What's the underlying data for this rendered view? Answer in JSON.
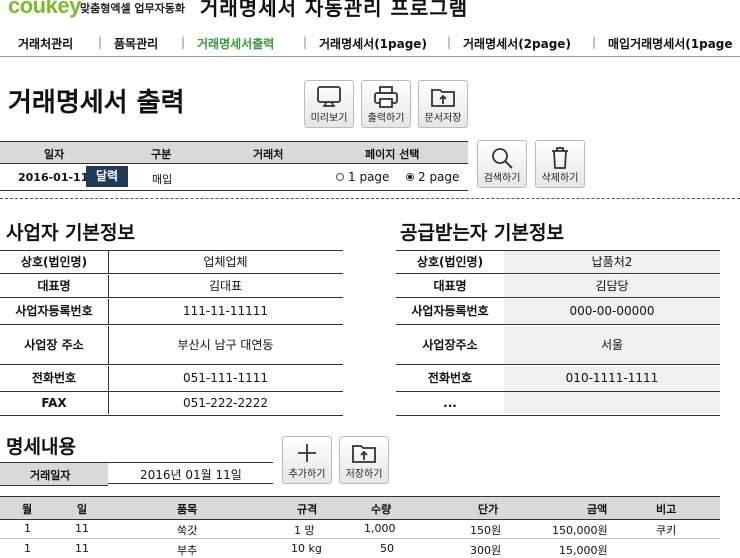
{
  "header": {
    "logo": "coukey",
    "logo_sub": "맞춤형엑셀 업무자동화",
    "app_title": "거래명세서 자동관리 프로그램"
  },
  "nav": {
    "items": [
      {
        "label": "거래처관리"
      },
      {
        "label": "품목관리"
      },
      {
        "label": "거래명세서출력"
      },
      {
        "label": "거래명세서(1page)"
      },
      {
        "label": "거래명세서(2page)"
      },
      {
        "label": "매입거래명세서(1page"
      }
    ],
    "separator": "|"
  },
  "page_title": "거래명세서 출력",
  "toolbar": {
    "preview": "미리보기",
    "print": "출력하기",
    "save_doc": "문서저장"
  },
  "search_bar": {
    "headers": {
      "date": "일자",
      "category": "구분",
      "client": "거래처",
      "page_select": "페이지 선택"
    },
    "date_value": "2016-01-11",
    "calendar_button": "달력",
    "category_value": "매입",
    "page_options": [
      {
        "label": "1 page",
        "selected": false
      },
      {
        "label": "2 page",
        "selected": true
      }
    ],
    "search_button": "검색하기",
    "delete_button": "삭제하기"
  },
  "supplier": {
    "title": "사업자 기본정보",
    "rows": [
      {
        "label": "상호(법인명)",
        "value": "업체업체"
      },
      {
        "label": "대표명",
        "value": "김대표"
      },
      {
        "label": "사업자등록번호",
        "value": "111-11-11111"
      },
      {
        "label": "사업장 주소",
        "value": "부산시 남구 대연동"
      },
      {
        "label": "전화번호",
        "value": "051-111-1111"
      },
      {
        "label": "FAX",
        "value": "051-222-2222"
      }
    ]
  },
  "receiver": {
    "title": "공급받는자 기본정보",
    "rows": [
      {
        "label": "상호(법인명)",
        "value": "납품처2"
      },
      {
        "label": "대표명",
        "value": "김담당"
      },
      {
        "label": "사업자등록번호",
        "value": "000-00-00000"
      },
      {
        "label": "사업장주소",
        "value": "서울"
      },
      {
        "label": "전화번호",
        "value": "010-1111-1111"
      },
      {
        "label": "...",
        "value": ""
      }
    ]
  },
  "details": {
    "title": "명세내용",
    "date_label": "거래일자",
    "date_value": "2016년 01월 11일",
    "add_button": "추가하기",
    "save_button": "저장하기",
    "columns": [
      "월",
      "일",
      "품목",
      "규격",
      "수량",
      "단가",
      "금액",
      "비고"
    ],
    "rows": [
      [
        "1",
        "11",
        "쑥갓",
        "1 망",
        "1,000",
        "150원",
        "150,000원",
        "쿠키"
      ],
      [
        "1",
        "11",
        "부추",
        "10 kg",
        "50",
        "300원",
        "15,000원",
        ""
      ]
    ]
  }
}
